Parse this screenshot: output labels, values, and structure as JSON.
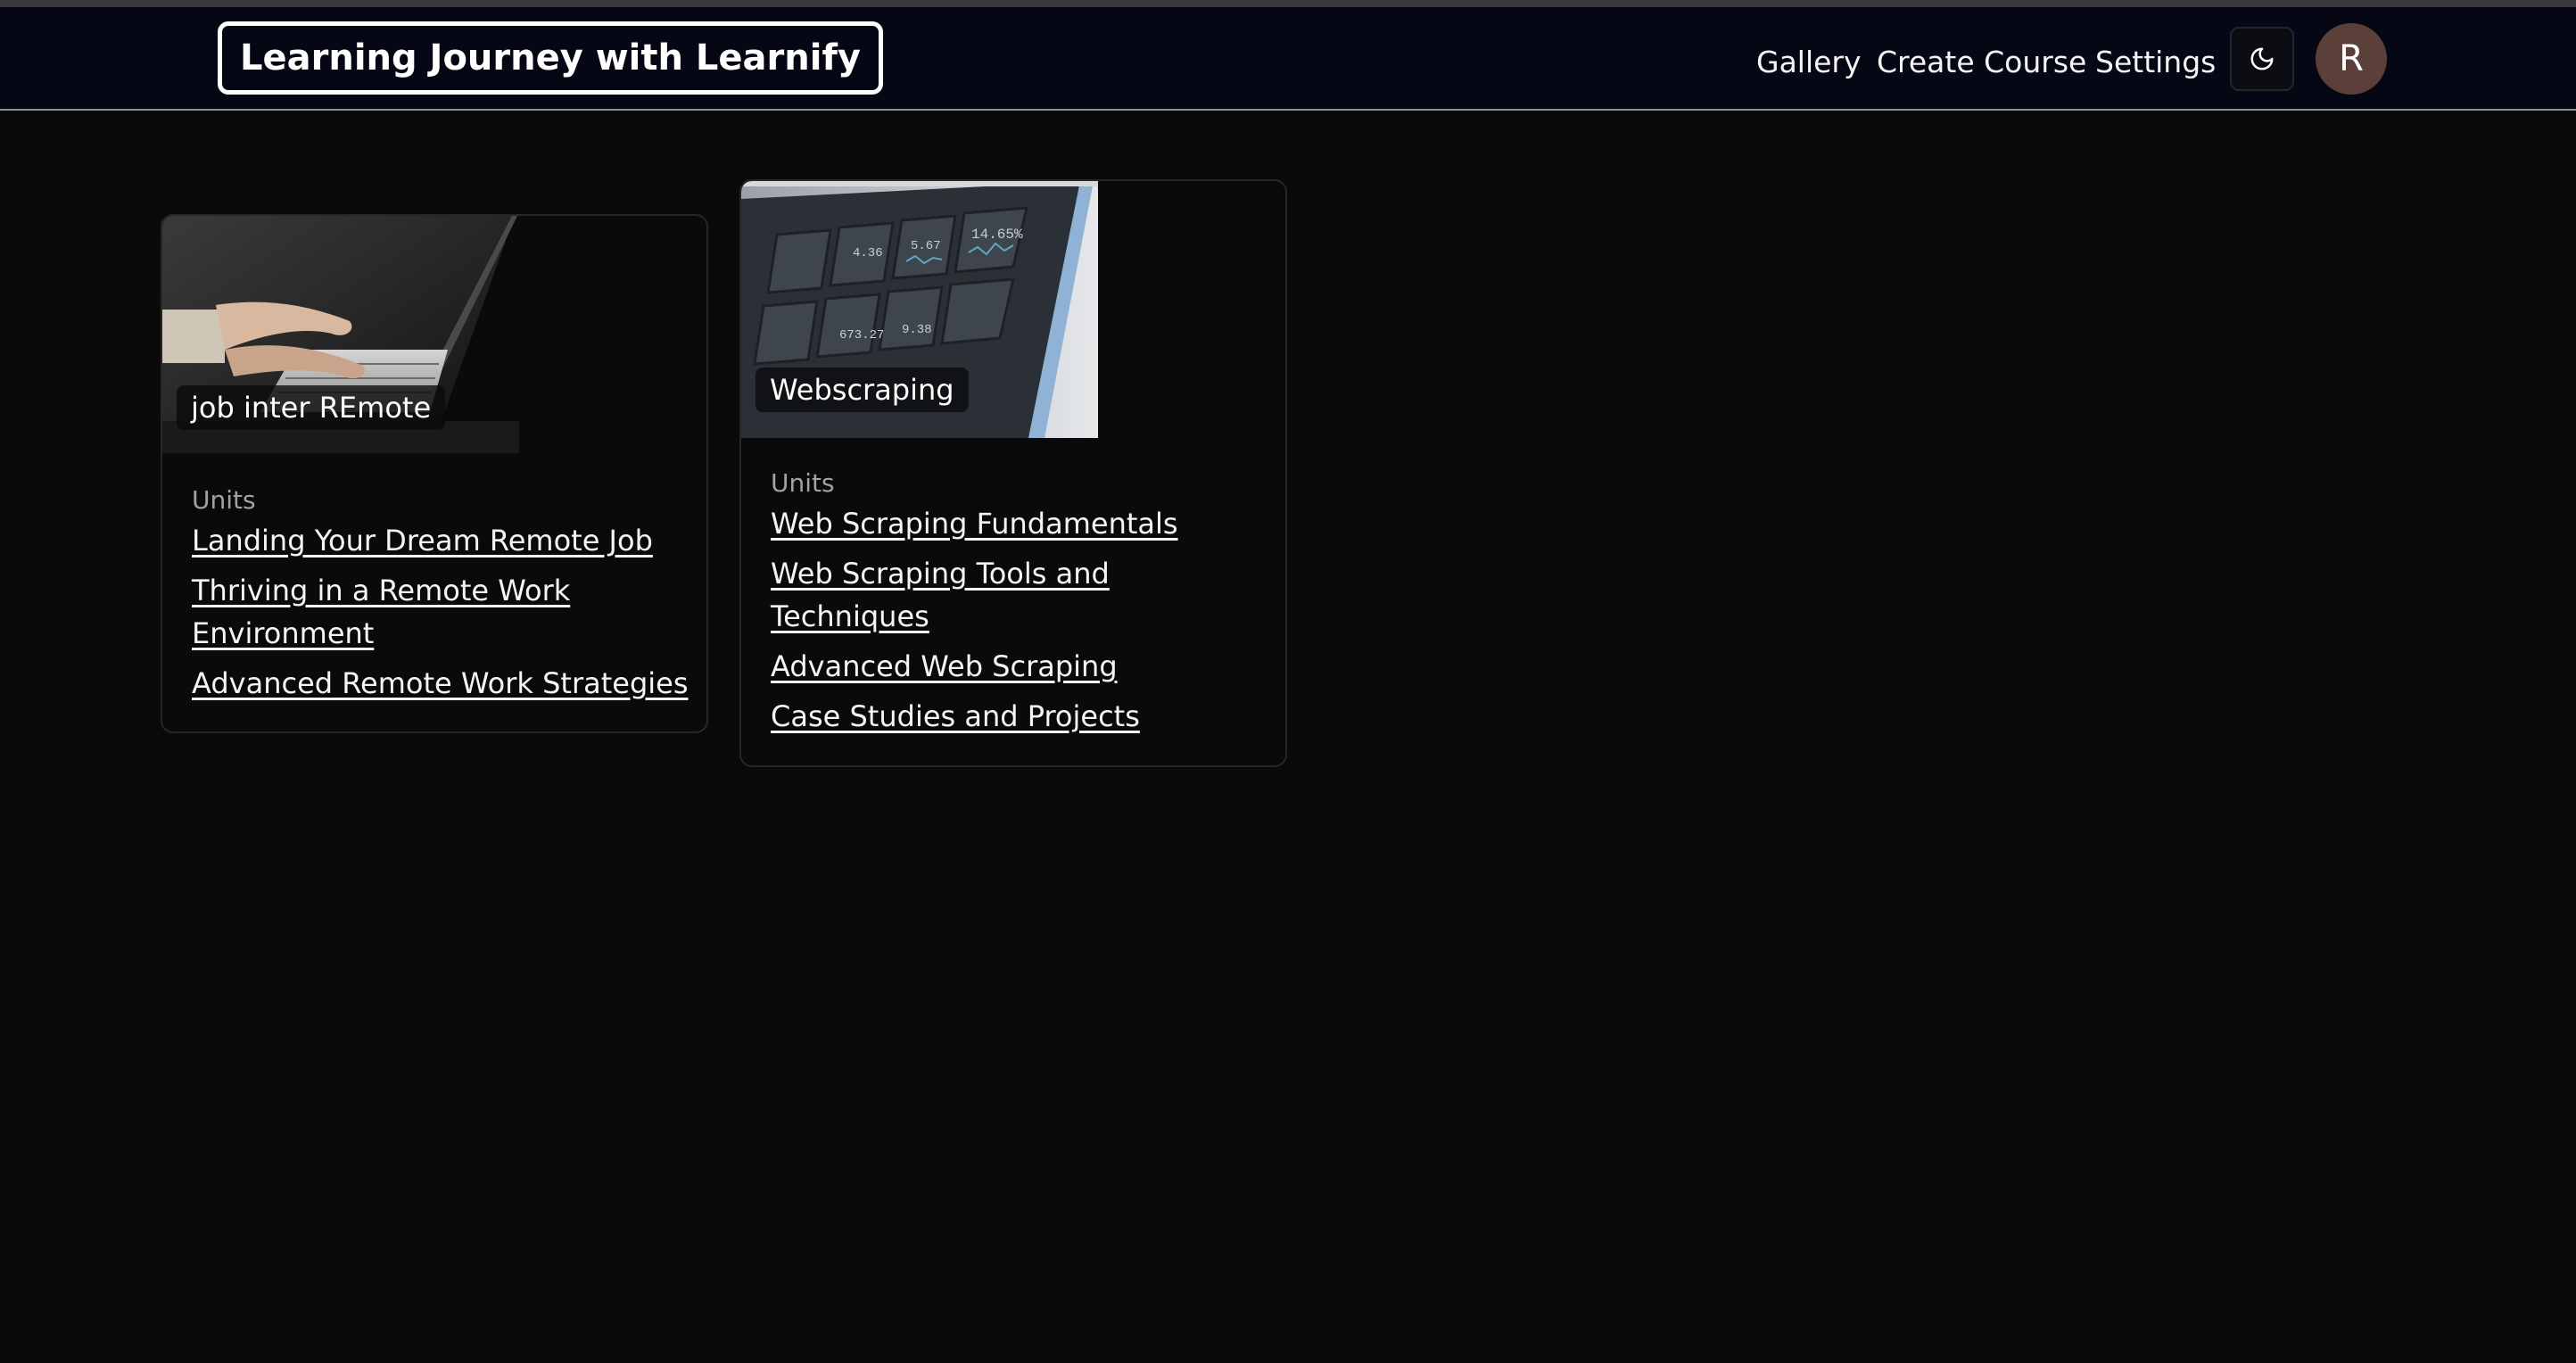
{
  "header": {
    "brand": "Learning Journey with Learnify",
    "nav": {
      "gallery": "Gallery",
      "create_course": "Create Course",
      "settings": "Settings"
    },
    "theme_icon": "moon-icon",
    "avatar_initial": "R"
  },
  "courses": [
    {
      "title": "job inter REmote",
      "units_label": "Units",
      "units": [
        "Landing Your Dream Remote Job",
        "Thriving in a Remote Work Environment",
        "Advanced Remote Work Strategies"
      ]
    },
    {
      "title": "Webscraping",
      "units_label": "Units",
      "units": [
        "Web Scraping Fundamentals",
        "Web Scraping Tools and Techniques",
        "Advanced Web Scraping",
        "Case Studies and Projects"
      ]
    }
  ],
  "colors": {
    "background": "#0a0a0a",
    "navbar": "#050814",
    "avatar": "#5a4039",
    "muted": "#a1a1aa"
  }
}
